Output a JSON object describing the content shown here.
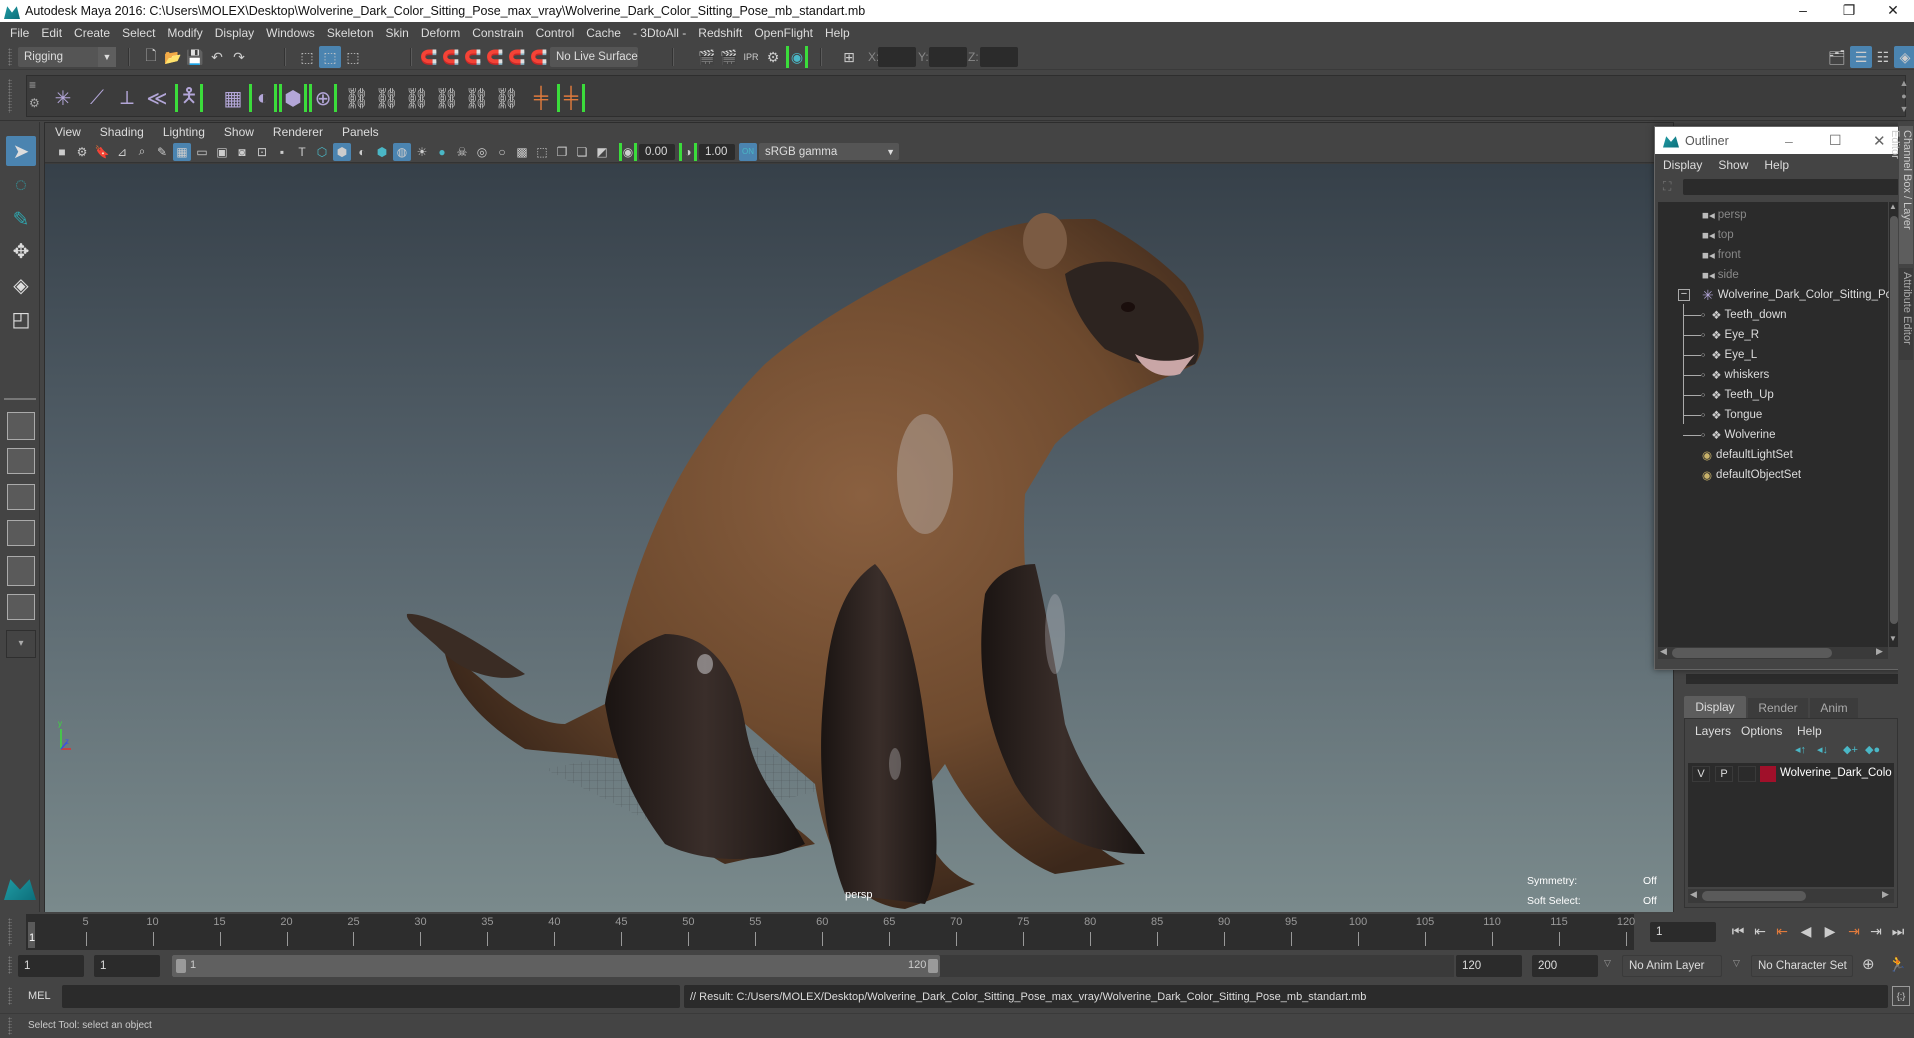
{
  "window": {
    "title": "Autodesk Maya 2016: C:\\Users\\MOLEX\\Desktop\\Wolverine_Dark_Color_Sitting_Pose_max_vray\\Wolverine_Dark_Color_Sitting_Pose_mb_standart.mb",
    "minimize": "–",
    "restore": "❐",
    "close": "✕"
  },
  "menubar": [
    "File",
    "Edit",
    "Create",
    "Select",
    "Modify",
    "Display",
    "Windows",
    "Skeleton",
    "Skin",
    "Deform",
    "Constrain",
    "Control",
    "Cache",
    "- 3DtoAll -",
    "Redshift",
    "OpenFlight",
    "Help"
  ],
  "statusline": {
    "menuset": "Rigging",
    "live_surface": "No Live Surface",
    "x_label": "X:",
    "y_label": "Y:",
    "z_label": "Z:",
    "x_value": "",
    "y_value": "",
    "z_value": ""
  },
  "viewport": {
    "menu": [
      "View",
      "Shading",
      "Lighting",
      "Show",
      "Renderer",
      "Panels"
    ],
    "exposure": "0.00",
    "gamma": "1.00",
    "color_space": "sRGB gamma",
    "camera_label": "persp",
    "hud": [
      {
        "label": "Symmetry:",
        "value": "Off"
      },
      {
        "label": "Soft Select:",
        "value": "Off"
      }
    ],
    "colors": {
      "fur_brown": "#7a5434",
      "fur_dark": "#231a17",
      "bg_top": "#364049",
      "bg_bottom": "#7a8a8c"
    }
  },
  "outliner": {
    "title": "Outliner",
    "menu": [
      "Display",
      "Show",
      "Help"
    ],
    "filter_value": "",
    "items": [
      {
        "label": "persp",
        "type": "camera",
        "dim": true
      },
      {
        "label": "top",
        "type": "camera",
        "dim": true
      },
      {
        "label": "front",
        "type": "camera",
        "dim": true
      },
      {
        "label": "side",
        "type": "camera",
        "dim": true
      },
      {
        "label": "Wolverine_Dark_Color_Sitting_Pose",
        "type": "group",
        "expanded": true
      },
      {
        "label": "Teeth_down",
        "type": "mesh",
        "child": true
      },
      {
        "label": "Eye_R",
        "type": "mesh",
        "child": true
      },
      {
        "label": "Eye_L",
        "type": "mesh",
        "child": true
      },
      {
        "label": "whiskers",
        "type": "mesh",
        "child": true
      },
      {
        "label": "Teeth_Up",
        "type": "mesh",
        "child": true
      },
      {
        "label": "Tongue",
        "type": "mesh",
        "child": true
      },
      {
        "label": "Wolverine",
        "type": "mesh",
        "child": true
      },
      {
        "label": "defaultLightSet",
        "type": "set"
      },
      {
        "label": "defaultObjectSet",
        "type": "set"
      }
    ]
  },
  "layer_editor": {
    "tabs": [
      "Display",
      "Render",
      "Anim"
    ],
    "active_tab": "Display",
    "menu": [
      "Layers",
      "Options",
      "Help"
    ],
    "layers": [
      {
        "v": "V",
        "p": "P",
        "color": "#a0102a",
        "name": "Wolverine_Dark_Color"
      }
    ]
  },
  "side_tabs": [
    "Channel Box / Layer Editor",
    "Attribute Editor"
  ],
  "timeline": {
    "ticks": [
      5,
      10,
      15,
      20,
      25,
      30,
      35,
      40,
      45,
      50,
      55,
      60,
      65,
      70,
      75,
      80,
      85,
      90,
      95,
      100,
      105,
      110,
      115,
      120
    ],
    "start": 1,
    "end": 120,
    "current_frame": "1",
    "current_frame_field": "1"
  },
  "range": {
    "start_time": "1",
    "playback_start": "1",
    "range_start_label": "1",
    "range_end_label": "120",
    "playback_end": "120",
    "end_time": "200",
    "anim_layer": "No Anim Layer",
    "character_set": "No Character Set"
  },
  "command": {
    "language": "MEL",
    "input": "",
    "result": "// Result: C:/Users/MOLEX/Desktop/Wolverine_Dark_Color_Sitting_Pose_max_vray/Wolverine_Dark_Color_Sitting_Pose_mb_standart.mb"
  },
  "help_line": "Select Tool: select an object"
}
